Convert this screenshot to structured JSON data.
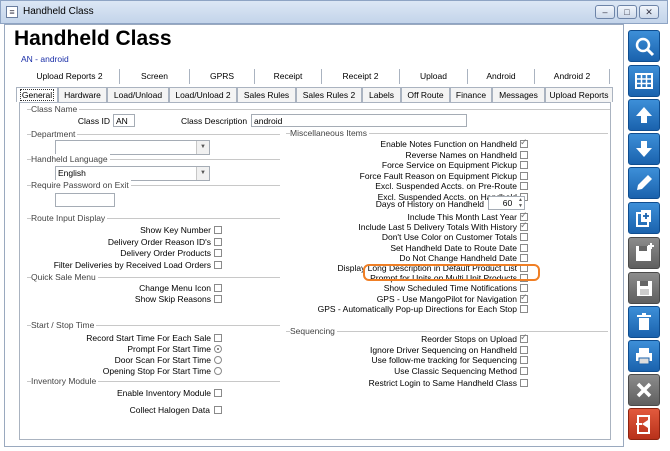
{
  "window": {
    "title": "Handheld Class",
    "min": "–",
    "max": "□",
    "close": "✕",
    "app_icon": "≡"
  },
  "header": {
    "title": "Handheld Class",
    "subtitle": "AN - android"
  },
  "tabs_row1": [
    "Upload Reports 2",
    "Screen",
    "GPRS",
    "Receipt",
    "Receipt 2",
    "Upload",
    "Android",
    "Android 2"
  ],
  "tabs_row2": [
    "General",
    "Hardware",
    "Load/Unload",
    "Load/Unload 2",
    "Sales Rules",
    "Sales Rules 2",
    "Labels",
    "Off Route",
    "Finance",
    "Messages",
    "Upload Reports"
  ],
  "class_name": {
    "group": "Class Name",
    "id_label": "Class ID",
    "id_value": "AN",
    "desc_label": "Class Description",
    "desc_value": "android"
  },
  "department": {
    "group": "Department",
    "value": ""
  },
  "language": {
    "group": "Handheld Language",
    "value": "English"
  },
  "password": {
    "group": "Require Password on Exit",
    "value": ""
  },
  "route_input": {
    "group": "Route Input Display",
    "items": [
      {
        "label": "Show Key Number",
        "checked": false
      },
      {
        "label": "Delivery Order Reason ID's",
        "checked": false
      },
      {
        "label": "Delivery Order Products",
        "checked": false
      },
      {
        "label": "Filter Deliveries by Received Load Orders",
        "checked": false
      }
    ]
  },
  "quick_sale": {
    "group": "Quick Sale Menu",
    "items": [
      {
        "label": "Change Menu Icon",
        "checked": false
      },
      {
        "label": "Show Skip Reasons",
        "checked": false
      }
    ]
  },
  "start_stop": {
    "group": "Start / Stop Time",
    "items": [
      {
        "label": "Record Start Time For Each Sale",
        "kind": "checkbox",
        "checked": false
      },
      {
        "label": "Prompt For Start Time",
        "kind": "radio",
        "checked": true
      },
      {
        "label": "Door Scan For Start Time",
        "kind": "radio",
        "checked": false
      },
      {
        "label": "Opening Stop For Start Time",
        "kind": "radio",
        "checked": false
      }
    ]
  },
  "inventory": {
    "group": "Inventory Module",
    "items": [
      {
        "label": "Enable Inventory Module",
        "checked": false
      }
    ]
  },
  "halogen": {
    "label": "Collect Halogen Data",
    "checked": false
  },
  "misc": {
    "group": "Miscellaneous Items",
    "items": [
      {
        "label": "Enable Notes Function on Handheld",
        "checked": true
      },
      {
        "label": "Reverse Names on Handheld",
        "checked": false
      },
      {
        "label": "Force Service on Equipment Pickup",
        "checked": false
      },
      {
        "label": "Force Fault Reason on Equipment Pickup",
        "checked": false
      },
      {
        "label": "Excl. Suspended Accts. on Pre-Route",
        "checked": false
      },
      {
        "label": "Excl. Suspended Accts. on Handheld",
        "checked": false
      }
    ],
    "days_label": "Days of History on Handheld",
    "days_value": "60",
    "items2": [
      {
        "label": "Include This Month Last Year",
        "checked": true
      },
      {
        "label": "Include Last 5 Delivery Totals With History",
        "checked": true
      },
      {
        "label": "Don't Use Color on Customer Totals",
        "checked": false
      },
      {
        "label": "Set Handheld Date to Route Date",
        "checked": false
      },
      {
        "label": "Do Not Change Handheld Date",
        "checked": false
      },
      {
        "label": "Display Long Description in Default Product List",
        "checked": false
      },
      {
        "label": "Prompt for Units on Multi Unit Products",
        "checked": false
      },
      {
        "label": "Show Scheduled Time Notifications",
        "checked": false
      },
      {
        "label": "GPS - Use MangoPilot for Navigation",
        "checked": true
      },
      {
        "label": "GPS - Automatically Pop-up Directions for Each Stop",
        "checked": false
      }
    ]
  },
  "sequencing": {
    "group": "Sequencing",
    "items": [
      {
        "label": "Reorder Stops on Upload",
        "checked": true
      },
      {
        "label": "Ignore Driver Sequencing on Handheld",
        "checked": false
      },
      {
        "label": "Use follow-me tracking for Sequencing",
        "checked": false
      },
      {
        "label": "Use Classic Sequencing Method",
        "checked": false
      }
    ]
  },
  "restrict": {
    "label": "Restrict Login to Same Handheld Class",
    "checked": false
  },
  "sidebar": [
    "search-icon",
    "grid-icon",
    "arrow-up-icon",
    "arrow-down-icon",
    "pencil-icon",
    "copy-add-icon",
    "save-new-icon",
    "save-icon",
    "trash-icon",
    "print-icon",
    "close-x-icon",
    "exit-door-icon"
  ],
  "colors": {
    "accent": "#1a62ad",
    "highlight": "#f07f25",
    "subtitle": "#1b2fa8"
  }
}
